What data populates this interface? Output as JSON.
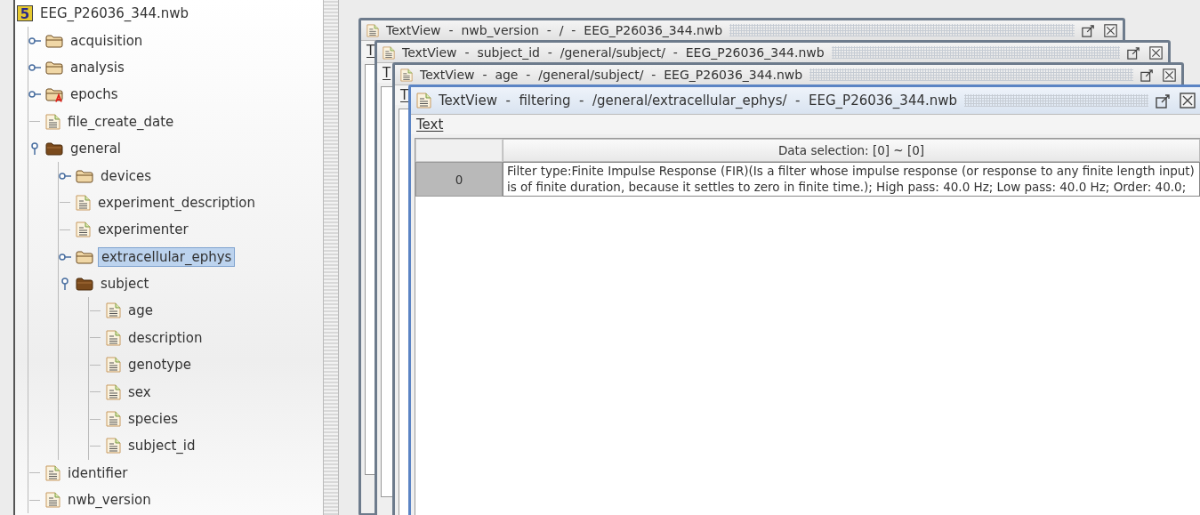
{
  "tree": {
    "label": "EEG_P26036_344.nwb",
    "kind": "file",
    "badge": "5",
    "selected": false,
    "children": [
      {
        "label": "acquisition",
        "kind": "group",
        "selected": false,
        "expanded": false
      },
      {
        "label": "analysis",
        "kind": "group",
        "selected": false,
        "expanded": false
      },
      {
        "label": "epochs",
        "kind": "group-flagged",
        "selected": false,
        "expanded": false
      },
      {
        "label": "file_create_date",
        "kind": "dataset",
        "selected": false
      },
      {
        "label": "general",
        "kind": "group",
        "selected": false,
        "expanded": true,
        "children": [
          {
            "label": "devices",
            "kind": "group",
            "selected": false,
            "expanded": false
          },
          {
            "label": "experiment_description",
            "kind": "dataset",
            "selected": false
          },
          {
            "label": "experimenter",
            "kind": "dataset",
            "selected": false
          },
          {
            "label": "extracellular_ephys",
            "kind": "group",
            "selected": true,
            "expanded": false
          },
          {
            "label": "subject",
            "kind": "group",
            "selected": false,
            "expanded": true,
            "children": [
              {
                "label": "age",
                "kind": "dataset",
                "selected": false
              },
              {
                "label": "description",
                "kind": "dataset",
                "selected": false
              },
              {
                "label": "genotype",
                "kind": "dataset",
                "selected": false
              },
              {
                "label": "sex",
                "kind": "dataset",
                "selected": false
              },
              {
                "label": "species",
                "kind": "dataset",
                "selected": false
              },
              {
                "label": "subject_id",
                "kind": "dataset",
                "selected": false
              }
            ]
          }
        ]
      },
      {
        "label": "identifier",
        "kind": "dataset",
        "selected": false
      },
      {
        "label": "nwb_version",
        "kind": "dataset",
        "selected": false
      }
    ]
  },
  "windows": [
    {
      "title": "TextView  -  nwb_version  -  /  -  EEG_P26036_344.nwb",
      "menu": "T"
    },
    {
      "title": "TextView  -  subject_id  -  /general/subject/  -  EEG_P26036_344.nwb",
      "menu": "T"
    },
    {
      "title": "TextView  -  age  -  /general/subject/  -  EEG_P26036_344.nwb",
      "menu": "T"
    },
    {
      "title": "TextView  -  filtering  -  /general/extracellular_ephys/  -  EEG_P26036_344.nwb",
      "menu": "Text",
      "table": {
        "header": "Data selection:   [0] ~ [0]",
        "rows": [
          {
            "index": "0",
            "value": "Filter type:Finite Impulse Response (FIR)(Is a filter whose impulse response (or response to any finite length input) is of finite duration, because it settles to zero in finite time.); High pass: 40.0 Hz; Low pass: 40.0 Hz; Order: 40.0;"
          }
        ]
      }
    }
  ]
}
